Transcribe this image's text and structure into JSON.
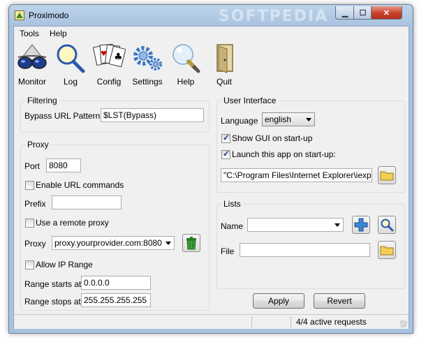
{
  "window": {
    "title": "Proximodo",
    "watermark": "SOFTPEDIA"
  },
  "menu": [
    "Tools",
    "Help"
  ],
  "toolbar": [
    {
      "label": "Monitor",
      "icon": "sunglasses-icon"
    },
    {
      "label": "Log",
      "icon": "magnifier-icon"
    },
    {
      "label": "Config",
      "icon": "playing-cards-icon"
    },
    {
      "label": "Settings",
      "icon": "gears-icon"
    },
    {
      "label": "Help",
      "icon": "lightbulb-icon"
    },
    {
      "label": "Quit",
      "icon": "door-icon"
    }
  ],
  "filtering": {
    "title": "Filtering",
    "bypass_label": "Bypass URL Pattern",
    "bypass_value": "$LST(Bypass)"
  },
  "proxy": {
    "title": "Proxy",
    "port_label": "Port",
    "port_value": "8080",
    "enable_url_commands": "Enable URL commands",
    "prefix_label": "Prefix",
    "prefix_value": "",
    "use_remote_proxy": "Use a remote proxy",
    "proxy_label": "Proxy",
    "proxy_value": "proxy.yourprovider.com:8080",
    "allow_ip_range": "Allow IP Range",
    "range_start_label": "Range starts at",
    "range_start_value": "0.0.0.0",
    "range_stop_label": "Range stops at",
    "range_stop_value": "255.255.255.255"
  },
  "ui": {
    "title": "User Interface",
    "language_label": "Language",
    "language_value": "english",
    "show_gui": "Show GUI on start-up",
    "show_gui_checked": true,
    "launch_app": "Launch this app on start-up:",
    "launch_app_checked": true,
    "app_path": "\"C:\\Program Files\\Internet Explorer\\iexplore"
  },
  "lists": {
    "title": "Lists",
    "name_label": "Name",
    "name_value": "",
    "file_label": "File",
    "file_value": ""
  },
  "buttons": {
    "apply": "Apply",
    "revert": "Revert"
  },
  "status": {
    "requests": "4/4 active requests"
  },
  "colors": {
    "titlebar": "#a9c3df",
    "close": "#c8402a",
    "folder": "#f3cf55",
    "trash": "#3fa33a",
    "plus": "#3b86d6"
  }
}
